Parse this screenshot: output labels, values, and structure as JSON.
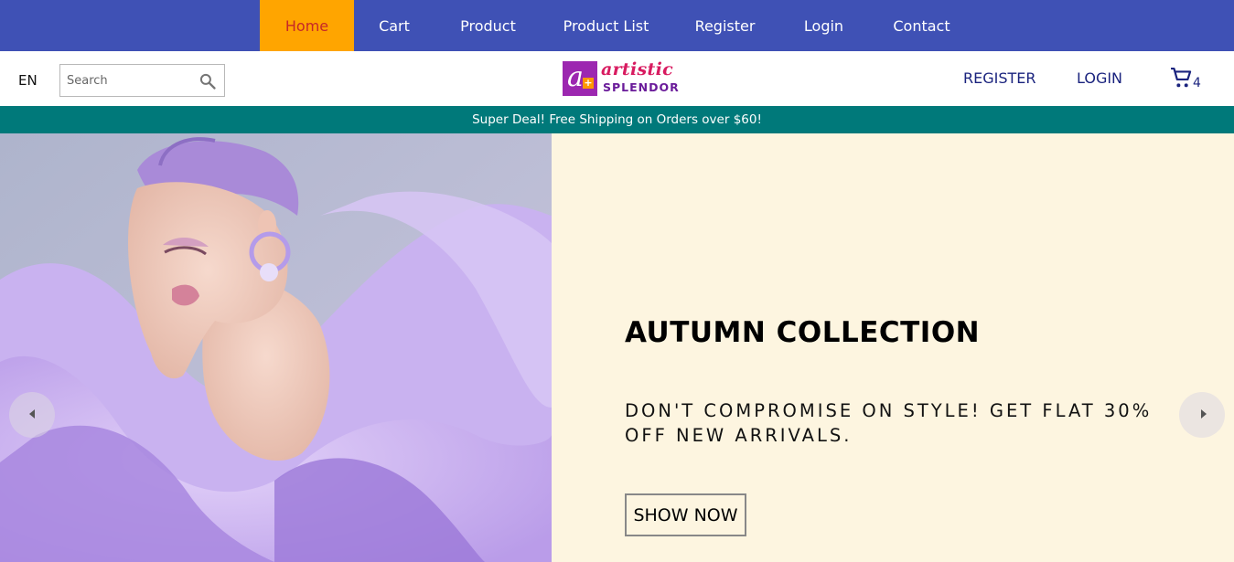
{
  "topnav": {
    "items": [
      {
        "label": "Home",
        "active": true
      },
      {
        "label": "Cart"
      },
      {
        "label": "Product"
      },
      {
        "label": "Product List"
      },
      {
        "label": "Register"
      },
      {
        "label": "Login"
      },
      {
        "label": "Contact"
      }
    ]
  },
  "header": {
    "lang": "EN",
    "search_placeholder": "Search",
    "logo": {
      "line1": "artistic",
      "line2": "SPLENDOR"
    },
    "register_label": "REGISTER",
    "login_label": "LOGIN",
    "cart_count": "4"
  },
  "announcement": "Super Deal! Free Shipping on Orders over $60!",
  "hero": {
    "title": "AUTUMN COLLECTION",
    "subtitle": "DON'T COMPROMISE ON STYLE! GET FLAT 30% OFF NEW ARRIVALS.",
    "button": "SHOW NOW"
  },
  "colors": {
    "nav_bg": "#3f51b5",
    "nav_active": "#ffa500",
    "announce_bg": "#00797a",
    "hero_bg": "#fdf5e0",
    "link": "#1a237e"
  }
}
